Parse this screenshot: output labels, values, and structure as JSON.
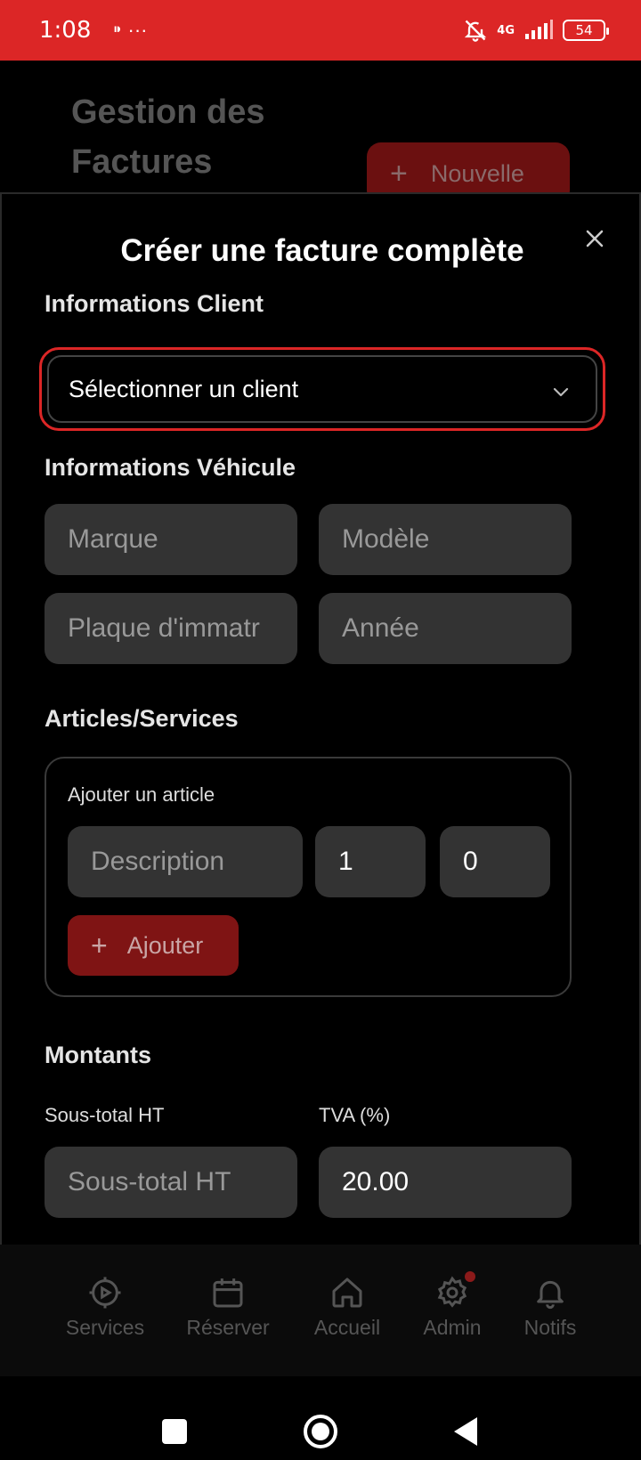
{
  "status_bar": {
    "time": "1:08",
    "extra_icons": "⁍ ···",
    "network": "4G",
    "battery": "54"
  },
  "background": {
    "title": "Gestion des Factures",
    "new_button": "Nouvelle"
  },
  "modal": {
    "title": "Créer une facture complète",
    "client_section": "Informations Client",
    "client_select_value": "Sélectionner un client",
    "vehicle_section": "Informations Véhicule",
    "vehicle_fields": {
      "brand_placeholder": "Marque",
      "model_placeholder": "Modèle",
      "plate_placeholder": "Plaque d'immatr",
      "year_placeholder": "Année"
    },
    "articles_section": "Articles/Services",
    "add_article_label": "Ajouter un article",
    "article_fields": {
      "description_placeholder": "Description",
      "quantity": "1",
      "price": "0"
    },
    "add_button": "Ajouter",
    "amounts_section": "Montants",
    "subtotal_label": "Sous-total HT",
    "vat_label": "TVA (%)",
    "subtotal_placeholder": "Sous-total HT",
    "vat_value": "20.00"
  },
  "bottom_nav": {
    "items": [
      {
        "label": "Services",
        "icon": "gear-play-icon"
      },
      {
        "label": "Réserver",
        "icon": "calendar-icon"
      },
      {
        "label": "Accueil",
        "icon": "home-icon"
      },
      {
        "label": "Admin",
        "icon": "settings-icon"
      },
      {
        "label": "Notifs",
        "icon": "bell-icon"
      }
    ]
  }
}
